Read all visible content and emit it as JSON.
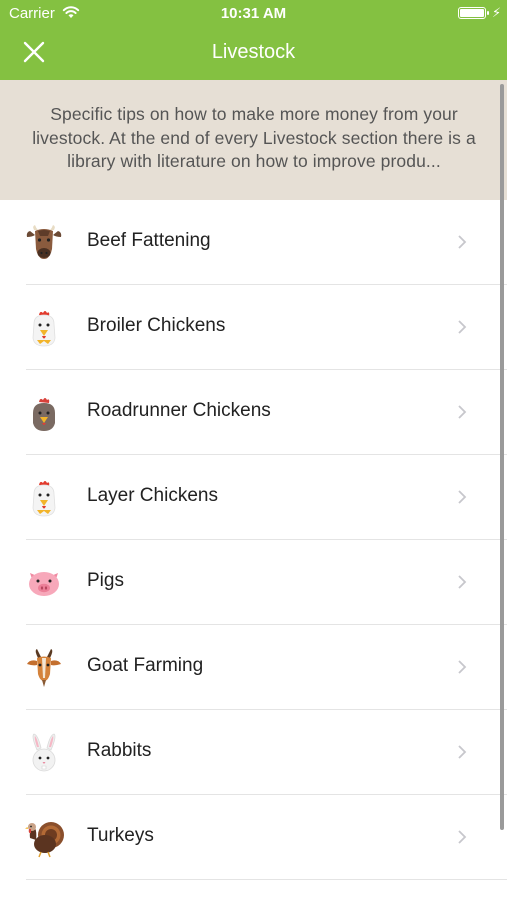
{
  "status_bar": {
    "carrier": "Carrier",
    "time": "10:31 AM"
  },
  "nav": {
    "title": "Livestock",
    "close_icon": "close-icon"
  },
  "intro": {
    "text": "Specific tips on how to make more money from your livestock. At the end of every Livestock section there is a library with literature on how to improve produ..."
  },
  "items": [
    {
      "label": "Beef Fattening",
      "icon": "cow-icon"
    },
    {
      "label": "Broiler Chickens",
      "icon": "white-chicken-icon"
    },
    {
      "label": "Roadrunner Chickens",
      "icon": "brown-chicken-icon"
    },
    {
      "label": "Layer Chickens",
      "icon": "white-chicken-icon"
    },
    {
      "label": "Pigs",
      "icon": "pig-icon"
    },
    {
      "label": "Goat Farming",
      "icon": "goat-icon"
    },
    {
      "label": "Rabbits",
      "icon": "rabbit-icon"
    },
    {
      "label": "Turkeys",
      "icon": "turkey-icon"
    }
  ],
  "colors": {
    "header": "#84c141",
    "intro_bg": "#e6dfd5"
  }
}
